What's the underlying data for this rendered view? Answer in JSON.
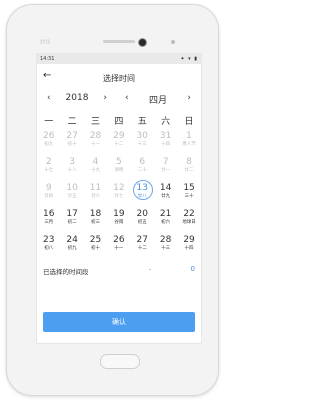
{
  "status": {
    "time": "14:31",
    "icons": "✦ ▾ ▮"
  },
  "header": {
    "title": "选择时间",
    "back_icon": "back-arrow-icon"
  },
  "nav": {
    "year": "2018",
    "month": "四月",
    "prev_icon": "chevron-left-icon",
    "next_icon": "chevron-right-icon"
  },
  "weekdays": [
    "一",
    "二",
    "三",
    "四",
    "五",
    "六",
    "日"
  ],
  "weeks": [
    [
      [
        "26",
        "初九",
        1
      ],
      [
        "27",
        "初十",
        1
      ],
      [
        "28",
        "十一",
        1
      ],
      [
        "29",
        "十二",
        1
      ],
      [
        "30",
        "十三",
        1
      ],
      [
        "31",
        "十四",
        1
      ],
      [
        "1",
        "愚人节",
        1
      ]
    ],
    [
      [
        "2",
        "十七",
        1
      ],
      [
        "3",
        "十八",
        1
      ],
      [
        "4",
        "十九",
        1
      ],
      [
        "5",
        "清明",
        1
      ],
      [
        "6",
        "二十",
        1
      ],
      [
        "7",
        "廿一",
        1
      ],
      [
        "8",
        "廿二",
        1
      ]
    ],
    [
      [
        "9",
        "廿四",
        1
      ],
      [
        "10",
        "廿五",
        1
      ],
      [
        "11",
        "廿六",
        1
      ],
      [
        "12",
        "廿七",
        1
      ],
      [
        "13",
        "廿八",
        2
      ],
      [
        "14",
        "廿九",
        0
      ],
      [
        "15",
        "三十",
        0
      ]
    ],
    [
      [
        "16",
        "三月",
        0
      ],
      [
        "17",
        "初二",
        0
      ],
      [
        "18",
        "初三",
        0
      ],
      [
        "19",
        "谷雨",
        0
      ],
      [
        "20",
        "初五",
        0
      ],
      [
        "21",
        "初六",
        0
      ],
      [
        "22",
        "地球日",
        0
      ]
    ],
    [
      [
        "23",
        "初八",
        0
      ],
      [
        "24",
        "初九",
        0
      ],
      [
        "25",
        "初十",
        0
      ],
      [
        "26",
        "十一",
        0
      ],
      [
        "27",
        "十二",
        0
      ],
      [
        "28",
        "十三",
        0
      ],
      [
        "29",
        "十四",
        0
      ]
    ]
  ],
  "selected": {
    "label": "已选择的时间段",
    "dash": "-",
    "count": "0"
  },
  "confirm_label": "确认",
  "colors": {
    "accent": "#4c9ff0",
    "today_ring": "#6fa6e8"
  }
}
